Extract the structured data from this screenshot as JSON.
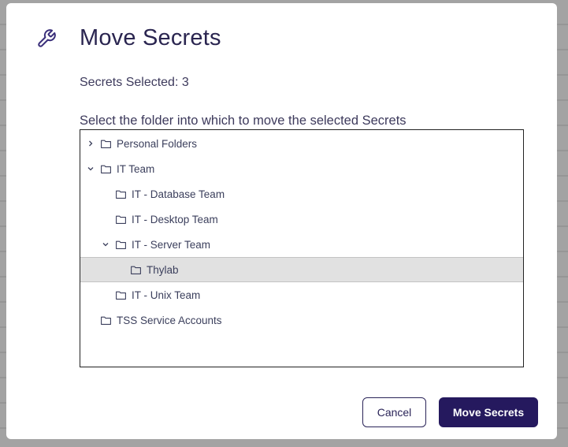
{
  "dialog": {
    "title": "Move Secrets",
    "selected_count_text": "Secrets Selected: 3",
    "instruction": "Select the folder into which to move the selected Secrets"
  },
  "tree": {
    "items": [
      {
        "label": "Personal Folders",
        "level": 0,
        "expander": "collapsed",
        "selected": false
      },
      {
        "label": "IT Team",
        "level": 0,
        "expander": "expanded",
        "selected": false
      },
      {
        "label": "IT - Database Team",
        "level": 1,
        "expander": "none",
        "selected": false
      },
      {
        "label": "IT - Desktop Team",
        "level": 1,
        "expander": "none",
        "selected": false
      },
      {
        "label": "IT - Server Team",
        "level": 1,
        "expander": "expanded",
        "selected": false
      },
      {
        "label": "Thylab",
        "level": 2,
        "expander": "none",
        "selected": true
      },
      {
        "label": "IT - Unix Team",
        "level": 1,
        "expander": "none",
        "selected": false
      },
      {
        "label": "TSS Service Accounts",
        "level": 0,
        "expander": "none",
        "selected": false
      }
    ]
  },
  "buttons": {
    "cancel": "Cancel",
    "move": "Move Secrets"
  },
  "icons": {
    "header": "wrench-icon",
    "folder": "folder-icon"
  },
  "colors": {
    "primary": "#25195e",
    "title_text": "#2a2550",
    "body_text": "#3d3a5c",
    "selected_row": "#e1e1e1"
  }
}
